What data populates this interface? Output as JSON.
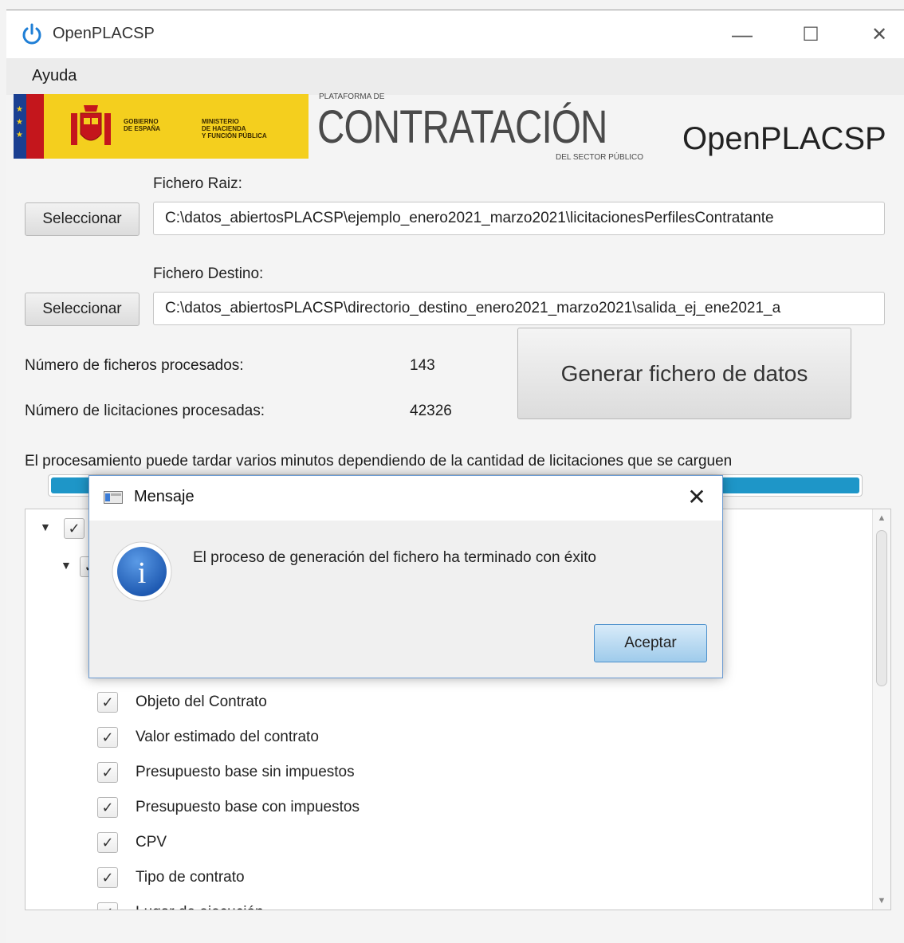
{
  "window": {
    "title": "OpenPLACSP",
    "minimize_glyph": "—",
    "maximize_glyph": "☐",
    "close_glyph": "✕"
  },
  "menu": {
    "items": [
      "Ayuda"
    ]
  },
  "header": {
    "gov_line1": "GOBIERNO\nDE ESPAÑA",
    "gov_line2": "MINISTERIO\nDE HACIENDA\nY FUNCIÓN PÚBLICA",
    "platform_top": "PLATAFORMA DE",
    "platform_main": "CONTRATACIÓN",
    "platform_sub": "DEL SECTOR PÚBLICO",
    "app_name": "OpenPLACSP"
  },
  "form": {
    "root_label": "Fichero Raiz:",
    "root_button": "Seleccionar",
    "root_path": "C:\\datos_abiertosPLACSP\\ejemplo_enero2021_marzo2021\\licitacionesPerfilesContratante",
    "dest_label": "Fichero Destino:",
    "dest_button": "Seleccionar",
    "dest_path": "C:\\datos_abiertosPLACSP\\directorio_destino_enero2021_marzo2021\\salida_ej_ene2021_a"
  },
  "stats": {
    "files_label": "Número de ficheros procesados:",
    "files_value": "143",
    "tenders_label": "Número de licitaciones procesadas:",
    "tenders_value": "42326"
  },
  "generate_button": "Generar fichero de datos",
  "info_text": "El procesamiento puede tardar varios minutos dependiendo de la cantidad de licitaciones que se carguen",
  "progress": {
    "value": 1.0
  },
  "tree": {
    "items": [
      "Objeto del Contrato",
      "Valor estimado del contrato",
      "Presupuesto base sin impuestos",
      "Presupuesto base con impuestos",
      "CPV",
      "Tipo de contrato",
      "Lugar de ejecución"
    ],
    "check_glyph": "✓",
    "expand_glyph": "▼"
  },
  "dialog": {
    "title": "Mensaje",
    "message": "El proceso de generación del fichero ha terminado con éxito",
    "ok_button": "Aceptar",
    "close_glyph": "✕",
    "info_glyph": "i"
  },
  "colors": {
    "progress": "#1e96c8",
    "info_icon": "#2b6cc4",
    "power_icon": "#1f7fd6",
    "ok_button": "#9fcbeb"
  }
}
